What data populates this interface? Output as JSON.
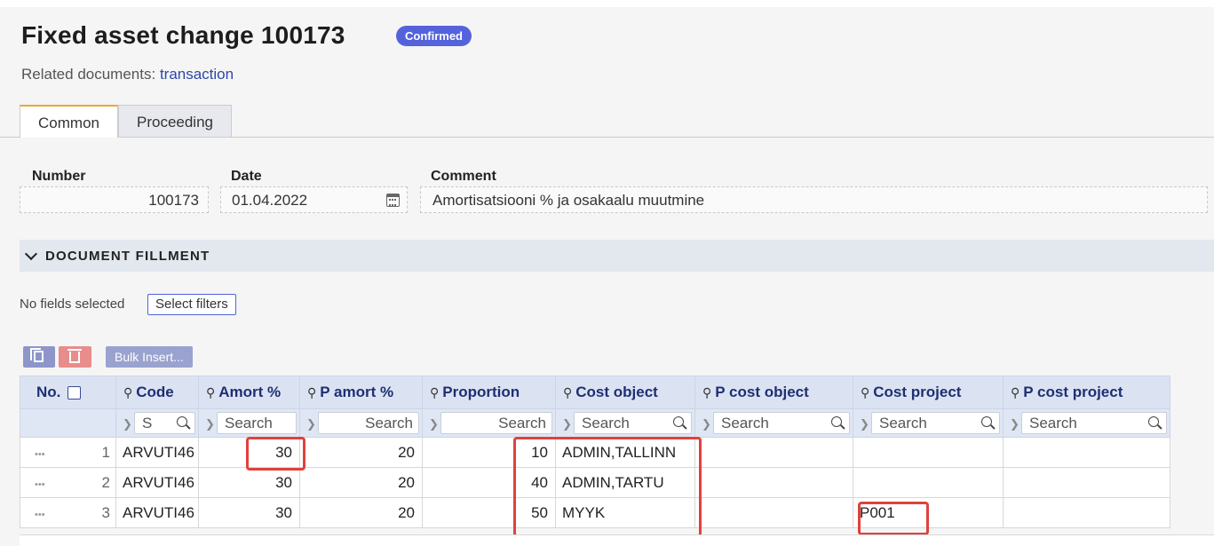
{
  "header": {
    "title": "Fixed asset change 100173",
    "status": "Confirmed",
    "related_label": "Related documents:",
    "related_link": "transaction"
  },
  "tabs": [
    {
      "label": "Common",
      "active": true
    },
    {
      "label": "Proceeding",
      "active": false
    }
  ],
  "form": {
    "number_label": "Number",
    "number_value": "100173",
    "date_label": "Date",
    "date_value": "01.04.2022",
    "comment_label": "Comment",
    "comment_value": "Amortisatsiooni % ja osakaalu muutmine"
  },
  "section": {
    "title": "DOCUMENT FILLMENT",
    "no_fields": "No fields selected",
    "select_filters": "Select filters"
  },
  "toolbar": {
    "copy_icon": "copy-icon",
    "delete_icon": "trash-icon",
    "bulk_insert": "Bulk Insert..."
  },
  "grid": {
    "columns": [
      "No.",
      "Code",
      "Amort %",
      "P amort %",
      "Proportion",
      "Cost object",
      "P cost object",
      "Cost project",
      "P cost project"
    ],
    "search_placeholder": "Search",
    "code_search_fragment": "S",
    "rows": [
      {
        "dots": "•••",
        "no": "1",
        "code": "ARVUTI46",
        "amort": "30",
        "p_amort": "20",
        "proportion": "10",
        "cost_object": "ADMIN,TALLINN",
        "p_cost_object": "",
        "cost_project": "",
        "p_cost_project": ""
      },
      {
        "dots": "•••",
        "no": "2",
        "code": "ARVUTI46",
        "amort": "30",
        "p_amort": "20",
        "proportion": "40",
        "cost_object": "ADMIN,TARTU",
        "p_cost_object": "",
        "cost_project": "",
        "p_cost_project": ""
      },
      {
        "dots": "•••",
        "no": "3",
        "code": "ARVUTI46",
        "amort": "30",
        "p_amort": "20",
        "proportion": "50",
        "cost_object": "MYYK",
        "p_cost_object": "",
        "cost_project": "P001",
        "p_cost_project": ""
      }
    ]
  },
  "colors": {
    "badge": "#5463dc",
    "highlight": "#e0413c",
    "header_bg": "#dbe3f3",
    "link": "#2d47a8"
  }
}
